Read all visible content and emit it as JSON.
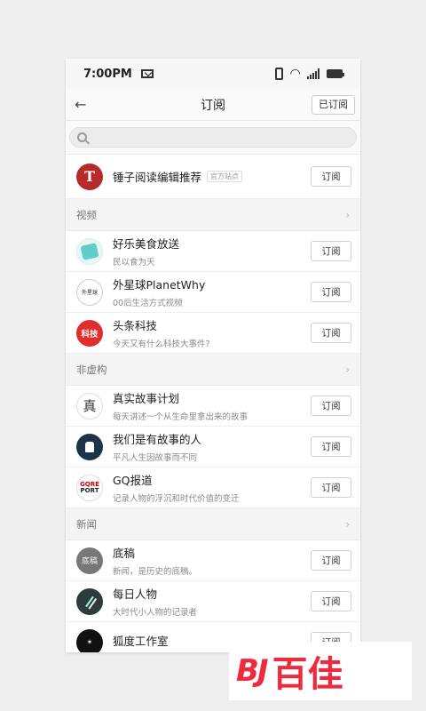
{
  "status_bar": {
    "time": "7:00PM"
  },
  "nav": {
    "title": "订阅",
    "subscribed_label": "已订阅"
  },
  "search": {
    "placeholder": ""
  },
  "featured": {
    "name": "锤子阅读编辑推荐",
    "tag": "官方站点",
    "button": "订阅"
  },
  "sections": [
    {
      "title": "视频",
      "items": [
        {
          "name": "好乐美食放送",
          "desc": "民以食为天",
          "button": "订阅"
        },
        {
          "name": "外星球PlanetWhy",
          "desc": "00后生活方式视频",
          "button": "订阅",
          "avatar_text": "外星球"
        },
        {
          "name": "头条科技",
          "desc": "今天又有什么科技大事件?",
          "button": "订阅",
          "avatar_text": "科技"
        }
      ]
    },
    {
      "title": "非虚构",
      "items": [
        {
          "name": "真实故事计划",
          "desc": "每天讲述一个从生命里拿出来的故事",
          "button": "订阅",
          "avatar_text": "真"
        },
        {
          "name": "我们是有故事的人",
          "desc": "平凡人生因故事而不同",
          "button": "订阅"
        },
        {
          "name": "GQ报道",
          "desc": "记录人物的浮沉和时代价值的变迁",
          "button": "订阅",
          "avatar_text_1": "GQRE",
          "avatar_text_2": "PORT"
        }
      ]
    },
    {
      "title": "新闻",
      "items": [
        {
          "name": "底稿",
          "desc": "新闻，是历史的底稿。",
          "button": "订阅",
          "avatar_text": "底稿"
        },
        {
          "name": "每日人物",
          "desc": "大时代小人物的记录者",
          "button": "订阅"
        },
        {
          "name": "狐度工作室",
          "desc": "",
          "button": "订阅"
        }
      ]
    }
  ],
  "watermark": {
    "logo": "BJ",
    "text": "百佳"
  }
}
